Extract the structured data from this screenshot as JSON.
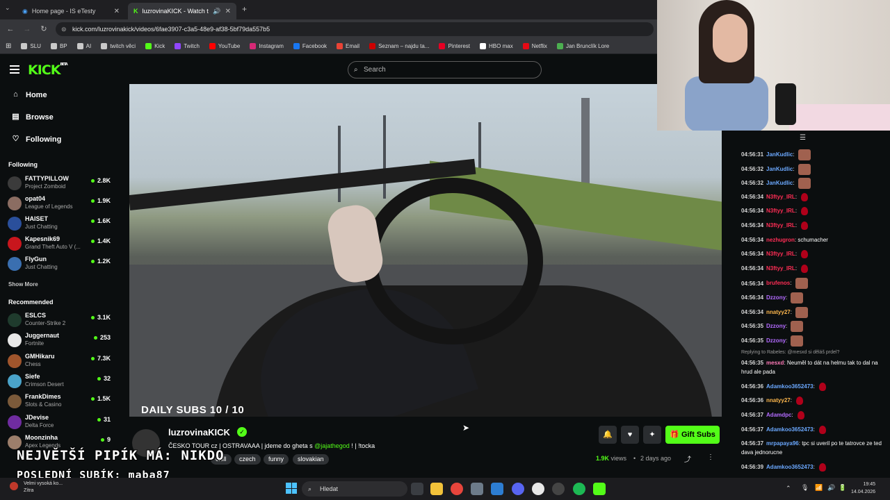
{
  "browser": {
    "tabs": [
      {
        "title": "Home page - IS eTesty"
      },
      {
        "title": "luzrovinaKICK - Watch the V"
      }
    ],
    "url": "kick.com/luzrovinakick/videos/6fae3907-c3a5-48e9-af38-5bf79da557b5",
    "bookmarks": [
      "SLU",
      "BP",
      "AI",
      "twitch věci",
      "Kick",
      "Twitch",
      "YouTube",
      "Instagram",
      "Facebook",
      "Email",
      "Seznam – najdu ta...",
      "Pinterest",
      "HBO max",
      "Netflix",
      "Jan Brunclík Lore"
    ]
  },
  "kick": {
    "logo": "KICK",
    "logo_sup": "BETA",
    "search_placeholder": "Search",
    "nav": [
      {
        "label": "Home",
        "icon": "home-icon"
      },
      {
        "label": "Browse",
        "icon": "browse-icon"
      },
      {
        "label": "Following",
        "icon": "heart-icon"
      }
    ],
    "following_title": "Following",
    "following": [
      {
        "name": "FATTYPILLOW",
        "game": "Project Zomboid",
        "viewers": "2.8K",
        "color": "#3b3b3b"
      },
      {
        "name": "opat04",
        "game": "League of Legends",
        "viewers": "1.9K",
        "color": "#8b6d62"
      },
      {
        "name": "HAISET",
        "game": "Just Chatting",
        "viewers": "1.6K",
        "color": "#2a4f9b"
      },
      {
        "name": "Kapesnik69",
        "game": "Grand Theft Auto V (...",
        "viewers": "1.4K",
        "color": "#c8161d"
      },
      {
        "name": "FlyGun",
        "game": "Just Chatting",
        "viewers": "1.2K",
        "color": "#3a6fb0"
      }
    ],
    "show_more": "Show More",
    "recommended_title": "Recommended",
    "recommended": [
      {
        "name": "ESLCS",
        "game": "Counter-Strike 2",
        "viewers": "3.1K",
        "color": "#1f3b2d"
      },
      {
        "name": "Juggernaut",
        "game": "Fortnite",
        "viewers": "253",
        "color": "#e8e8e8"
      },
      {
        "name": "GMHikaru",
        "game": "Chess",
        "viewers": "7.3K",
        "color": "#a0552c"
      },
      {
        "name": "Siefe",
        "game": "Crimson Desert",
        "viewers": "32",
        "color": "#4aa3c9"
      },
      {
        "name": "FrankDimes",
        "game": "Slots & Casino",
        "viewers": "1.5K",
        "color": "#7b5a3a"
      },
      {
        "name": "JDevise",
        "game": "Delta Force",
        "viewers": "31",
        "color": "#6f2ca0"
      },
      {
        "name": "Moonzinha",
        "game": "Apex Legends",
        "viewers": "9",
        "color": "#9c7e6b"
      }
    ],
    "video_overlay": "DAILY SUBS 10 / 10",
    "stream": {
      "streamer": "luzrovinaKICK",
      "title_before": "ČESKO TOUR cz | OSTRAVAAA | jdeme do gheta s ",
      "title_mention": "@jajathegod",
      "title_after": " ! | !tocka",
      "tags": [
        "chill",
        "czech",
        "funny",
        "slovakian"
      ],
      "gift_subs": "Gift Subs",
      "views": "1.9K",
      "views_label": "views",
      "ago": "2 days ago"
    },
    "chat": [
      {
        "time": "04:56:31",
        "user": "JanKudlic",
        "color": "#6ba8ff",
        "text": "",
        "emote": "tile"
      },
      {
        "time": "04:56:32",
        "user": "JanKudlic",
        "color": "#6ba8ff",
        "text": "",
        "emote": "tile"
      },
      {
        "time": "04:56:32",
        "user": "JanKudlic",
        "color": "#6ba8ff",
        "text": "",
        "emote": "tile"
      },
      {
        "time": "04:56:34",
        "user": "N3ftyy_IRL",
        "color": "#ff2d55",
        "text": "",
        "emote": "rose"
      },
      {
        "time": "04:56:34",
        "user": "N3ftyy_IRL",
        "color": "#ff2d55",
        "text": "",
        "emote": "rose"
      },
      {
        "time": "04:56:34",
        "user": "N3ftyy_IRL",
        "color": "#ff2d55",
        "text": "",
        "emote": "rose"
      },
      {
        "time": "04:56:34",
        "user": "nezhugron",
        "color": "#ff2d55",
        "text": "schumacher",
        "emote": ""
      },
      {
        "time": "04:56:34",
        "user": "N3ftyy_IRL",
        "color": "#ff2d55",
        "text": "",
        "emote": "rose"
      },
      {
        "time": "04:56:34",
        "user": "N3ftyy_IRL",
        "color": "#ff2d55",
        "text": "",
        "emote": "rose"
      },
      {
        "time": "04:56:34",
        "user": "brufenos",
        "color": "#ff2d55",
        "text": "",
        "emote": "tile"
      },
      {
        "time": "04:56:34",
        "user": "Dzzony",
        "color": "#b36bff",
        "text": "",
        "emote": "tile"
      },
      {
        "time": "04:56:34",
        "user": "nnatyy27",
        "color": "#ffb84d",
        "text": "",
        "emote": "tile"
      },
      {
        "time": "04:56:35",
        "user": "Dzzony",
        "color": "#b36bff",
        "text": "",
        "emote": "tile"
      },
      {
        "time": "04:56:35",
        "user": "Dzzony",
        "color": "#b36bff",
        "text": "",
        "emote": "tile"
      }
    ],
    "reply_note": "Replying to Rabeles: @mesxd si děláš prdel?",
    "chat2": [
      {
        "time": "04:56:35",
        "user": "mesxd",
        "color": "#ff7ab8",
        "text": "Neuměl to dát na helmu tak to dal na hrud ale pada"
      },
      {
        "time": "04:56:36",
        "user": "Adamkoo3652473",
        "color": "#6ba8ff",
        "text": ""
      },
      {
        "time": "04:56:36",
        "user": "nnatyy27",
        "color": "#ffb84d",
        "text": ""
      },
      {
        "time": "04:56:37",
        "user": "Adamdpc",
        "color": "#b36bff",
        "text": ""
      },
      {
        "time": "04:56:37",
        "user": "Adamkoo3652473",
        "color": "#6ba8ff",
        "text": ""
      },
      {
        "time": "04:56:37",
        "user": "mrpapaya96",
        "color": "#6ba8ff",
        "text": "tpc si uveril po te tatrovce ze ted dava jednorucne"
      },
      {
        "time": "04:56:39",
        "user": "Adamkoo3652473",
        "color": "#6ba8ff",
        "text": ""
      }
    ]
  },
  "overlay": {
    "line1": "NEJVĚTŠÍ PIPÍK MÁ: NIKDO",
    "line2": "POSLEDNÍ SUBÍK: maba87"
  },
  "taskbar": {
    "weather1": "Velmi vysoká ko...",
    "weather2": "Zítra",
    "search": "Hledat",
    "time": "19:45",
    "date": "14.04.2026"
  }
}
